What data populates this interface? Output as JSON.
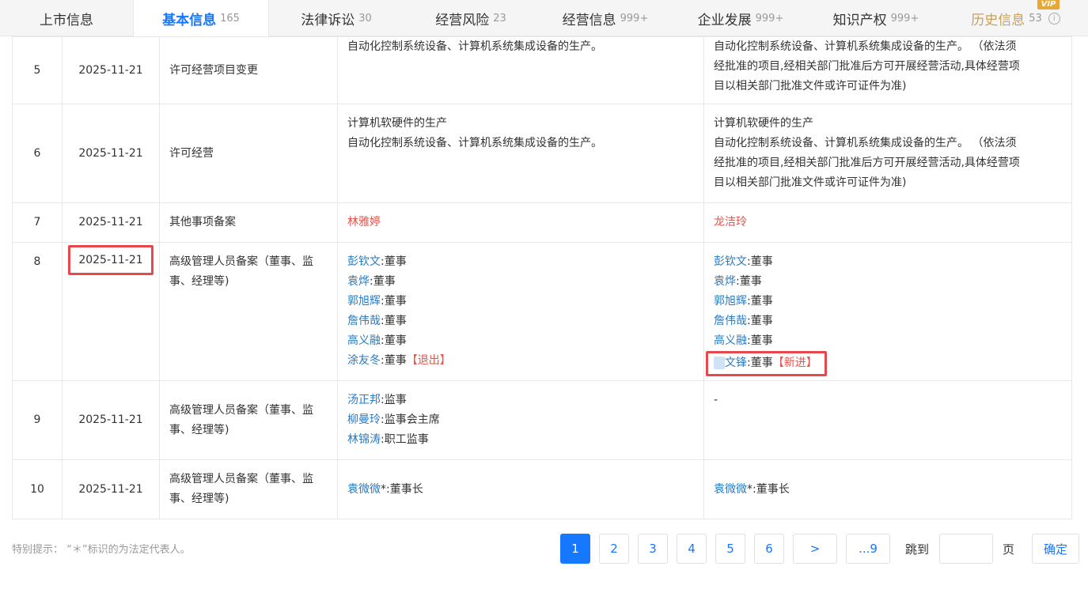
{
  "tabs": [
    {
      "label": "上市信息",
      "count": ""
    },
    {
      "label": "基本信息",
      "count": "165"
    },
    {
      "label": "法律诉讼",
      "count": "30"
    },
    {
      "label": "经营风险",
      "count": "23"
    },
    {
      "label": "经营信息",
      "count": "999+"
    },
    {
      "label": "企业发展",
      "count": "999+"
    },
    {
      "label": "知识产权",
      "count": "999+"
    },
    {
      "label": "历史信息",
      "count": "53",
      "badge": "VIP"
    }
  ],
  "rows": [
    {
      "no": "5",
      "date": "2025-11-21",
      "item": "许可经营项目变更",
      "before": [
        "自动化控制系统设备、计算机系统集成设备的生产。"
      ],
      "after": [
        "自动化控制系统设备、计算机系统集成设备的生产。 （依法须",
        "经批准的项目,经相关部门批准后方可开展经营活动,具体经营项",
        "目以相关部门批准文件或许可证件为准)"
      ]
    },
    {
      "no": "6",
      "date": "2025-11-21",
      "item": "许可经营",
      "before": [
        "计算机软硬件的生产",
        "自动化控制系统设备、计算机系统集成设备的生产。"
      ],
      "after": [
        "计算机软硬件的生产",
        "自动化控制系统设备、计算机系统集成设备的生产。 （依法须",
        "经批准的项目,经相关部门批准后方可开展经营活动,具体经营项",
        "目以相关部门批准文件或许可证件为准)"
      ]
    },
    {
      "no": "7",
      "date": "2025-11-21",
      "item": "其他事项备案",
      "before_name": "林雅婷",
      "after_name": "龙洁玲"
    },
    {
      "no": "8",
      "date": "2025-11-21",
      "item": "高级管理人员备案（董事、监事、经理等)",
      "before": [
        {
          "name": "彭钦文",
          "role": ":董事"
        },
        {
          "name": "袁烨",
          "role": ":董事"
        },
        {
          "name": "郭旭辉",
          "role": ":董事"
        },
        {
          "name": "詹伟哉",
          "role": ":董事"
        },
        {
          "name": "高义融",
          "role": ":董事"
        },
        {
          "name": "涂友冬",
          "role": ":董事",
          "tag": "【退出】"
        }
      ],
      "after": [
        {
          "name": "彭钦文",
          "role": ":董事"
        },
        {
          "name": "袁烨",
          "role": ":董事"
        },
        {
          "name": "郭旭辉",
          "role": ":董事"
        },
        {
          "name": "詹伟哉",
          "role": ":董事"
        },
        {
          "name": "高义融",
          "role": ":董事"
        },
        {
          "name": "文锋",
          "role": ":董事",
          "tag": "【新进】"
        }
      ]
    },
    {
      "no": "9",
      "date": "2025-11-21",
      "item": "高级管理人员备案（董事、监事、经理等)",
      "before": [
        {
          "name": "汤正邦",
          "role": ":监事"
        },
        {
          "name": "柳曼玲",
          "role": ":监事会主席"
        },
        {
          "name": "林锦涛",
          "role": ":职工监事"
        }
      ],
      "after_text": "-"
    },
    {
      "no": "10",
      "date": "2025-11-21",
      "item": "高级管理人员备案（董事、监事、经理等)",
      "before": [
        {
          "name": "袁微微",
          "role": "*:董事长"
        }
      ],
      "after": [
        {
          "name": "袁微微",
          "role": "*:董事长"
        }
      ]
    }
  ],
  "footer": {
    "tip": "特别提示： “＊”标识的为法定代表人。",
    "pages": [
      "1",
      "2",
      "3",
      "4",
      "5",
      "6",
      ">",
      "...9"
    ],
    "jump_label": "跳到",
    "page_unit": "页",
    "confirm": "确定"
  }
}
